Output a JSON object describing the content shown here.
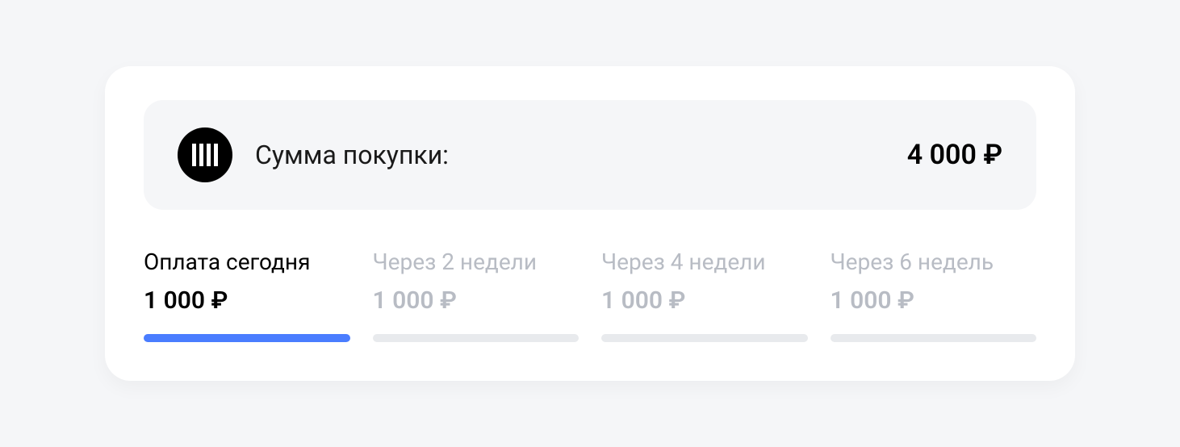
{
  "summary": {
    "label": "Сумма покупки:",
    "amount": "4 000 ₽"
  },
  "installments": [
    {
      "label": "Оплата сегодня",
      "amount": "1 000 ₽",
      "active": true
    },
    {
      "label": "Через 2 недели",
      "amount": "1 000 ₽",
      "active": false
    },
    {
      "label": "Через 4 недели",
      "amount": "1 000 ₽",
      "active": false
    },
    {
      "label": "Через 6 недель",
      "amount": "1 000 ₽",
      "active": false
    }
  ],
  "colors": {
    "accent": "#4a7dff",
    "inactive": "#b8bcc4",
    "panel": "#f5f6f8"
  }
}
